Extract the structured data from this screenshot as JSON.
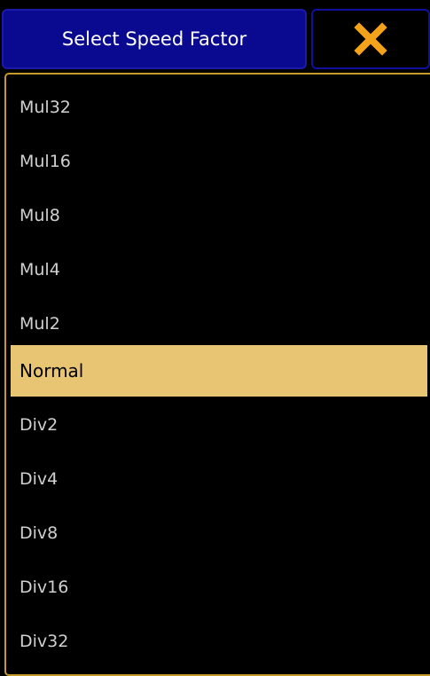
{
  "header": {
    "title": "Select Speed Factor",
    "close_icon": "close-x-icon",
    "close_color": "#f5a21b"
  },
  "list": {
    "selected_index": 5,
    "items": [
      {
        "label": "Mul32"
      },
      {
        "label": "Mul16"
      },
      {
        "label": "Mul8"
      },
      {
        "label": "Mul4"
      },
      {
        "label": "Mul2"
      },
      {
        "label": "Normal"
      },
      {
        "label": "Div2"
      },
      {
        "label": "Div4"
      },
      {
        "label": "Div8"
      },
      {
        "label": "Div16"
      },
      {
        "label": "Div32"
      }
    ]
  },
  "colors": {
    "title_bg": "#0a0a90",
    "list_border": "#c59a2a",
    "selected_bg": "#e8c573",
    "item_text": "#d0d0d0"
  }
}
